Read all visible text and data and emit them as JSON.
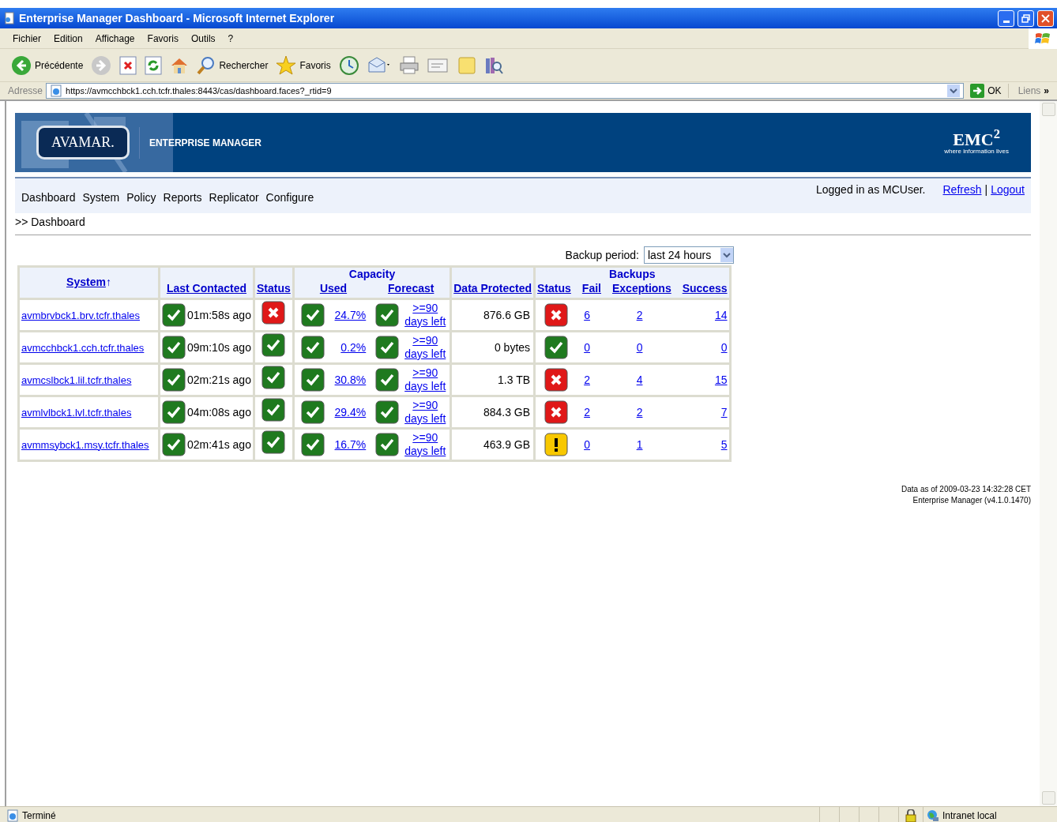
{
  "window": {
    "title": "Enterprise Manager Dashboard - Microsoft Internet Explorer"
  },
  "menu": [
    "Fichier",
    "Edition",
    "Affichage",
    "Favoris",
    "Outils",
    "?"
  ],
  "toolbar": [
    {
      "kind": "back",
      "label": "Précédente"
    },
    {
      "kind": "forward"
    },
    {
      "kind": "stop"
    },
    {
      "kind": "refresh"
    },
    {
      "kind": "home"
    },
    {
      "kind": "search",
      "label": "Rechercher"
    },
    {
      "kind": "favorites",
      "label": "Favoris"
    },
    {
      "kind": "history"
    },
    {
      "kind": "mail"
    },
    {
      "kind": "print"
    },
    {
      "kind": "edit"
    },
    {
      "kind": "note"
    },
    {
      "kind": "research"
    }
  ],
  "address": {
    "label": "Adresse",
    "value": "https://avmcchbck1.cch.tcfr.thales:8443/cas/dashboard.faces?_rtid=9",
    "go": "OK",
    "links": "Liens",
    "more": "»"
  },
  "app": {
    "logo": "AVAMAR.",
    "product": "ENTERPRISE MANAGER",
    "brand": "EMC$^{2}$",
    "tagline": "where information lives"
  },
  "nav": {
    "items": [
      "Dashboard",
      "System",
      "Policy",
      "Reports",
      "Replicator",
      "Configure"
    ],
    "user": "Logged in as MCUser.",
    "links": [
      "Refresh",
      "Logout"
    ],
    "separator": "|"
  },
  "breadcrumb": ">> Dashboard",
  "backup_period": {
    "label": "Backup period:",
    "value": "last 24 hours"
  },
  "table": {
    "headers": {
      "system": "System",
      "sort_mark": "↑",
      "last_contacted": "Last Contacted",
      "status": "Status",
      "capacity": "Capacity",
      "used": "Used",
      "forecast": "Forecast",
      "data_protected": "Data Protected",
      "backups": "Backups",
      "backup_status": "Status",
      "fail": "Fail",
      "exceptions": "Exceptions",
      "success": "Success"
    },
    "rows": [
      {
        "system": "avmbrvbck1.brv.tcfr.thales",
        "contact_status": {
          "kind": "ok"
        },
        "last_contacted": "01m:58s ago",
        "status": {
          "kind": "error"
        },
        "used_status": {
          "kind": "ok"
        },
        "used": "24.7%",
        "forecast_status": {
          "kind": "ok"
        },
        "forecast": ">=90 days left",
        "data_protected": "876.6 GB",
        "backup_status": {
          "kind": "error"
        },
        "fail": "6",
        "exceptions": "2",
        "success": "14"
      },
      {
        "system": "avmcchbck1.cch.tcfr.thales",
        "contact_status": {
          "kind": "ok"
        },
        "last_contacted": "09m:10s ago",
        "status": {
          "kind": "ok"
        },
        "used_status": {
          "kind": "ok"
        },
        "used": "0.2%",
        "forecast_status": {
          "kind": "ok"
        },
        "forecast": ">=90 days left",
        "data_protected": "0 bytes",
        "backup_status": {
          "kind": "ok"
        },
        "fail": "0",
        "exceptions": "0",
        "success": "0"
      },
      {
        "system": "avmcslbck1.lil.tcfr.thales",
        "contact_status": {
          "kind": "ok"
        },
        "last_contacted": "02m:21s ago",
        "status": {
          "kind": "ok"
        },
        "used_status": {
          "kind": "ok"
        },
        "used": "30.8%",
        "forecast_status": {
          "kind": "ok"
        },
        "forecast": ">=90 days left",
        "data_protected": "1.3 TB",
        "backup_status": {
          "kind": "error"
        },
        "fail": "2",
        "exceptions": "4",
        "success": "15"
      },
      {
        "system": "avmlvlbck1.lvl.tcfr.thales",
        "contact_status": {
          "kind": "ok"
        },
        "last_contacted": "04m:08s ago",
        "status": {
          "kind": "ok"
        },
        "used_status": {
          "kind": "ok"
        },
        "used": "29.4%",
        "forecast_status": {
          "kind": "ok"
        },
        "forecast": ">=90 days left",
        "data_protected": "884.3 GB",
        "backup_status": {
          "kind": "error"
        },
        "fail": "2",
        "exceptions": "2",
        "success": "7"
      },
      {
        "system": "avmmsybck1.msy.tcfr.thales",
        "contact_status": {
          "kind": "ok"
        },
        "last_contacted": "02m:41s ago",
        "status": {
          "kind": "ok"
        },
        "used_status": {
          "kind": "ok"
        },
        "used": "16.7%",
        "forecast_status": {
          "kind": "ok"
        },
        "forecast": ">=90 days left",
        "data_protected": "463.9 GB",
        "backup_status": {
          "kind": "warning"
        },
        "fail": "0",
        "exceptions": "1",
        "success": "5"
      }
    ]
  },
  "footer": [
    "Data as of 2009-03-23 14:32:28 CET",
    "Enterprise Manager (v4.1.0.1470)"
  ],
  "status_bar": {
    "text": "Terminé",
    "zone": "Intranet local"
  }
}
